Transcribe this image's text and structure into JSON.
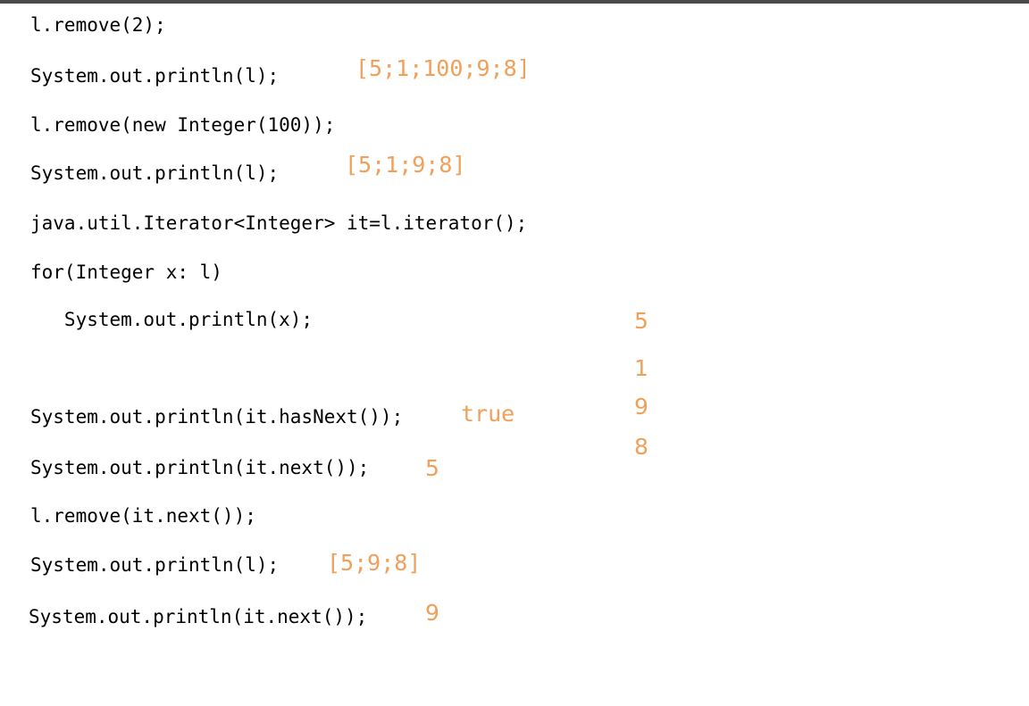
{
  "code_lines": [
    "l.remove(2);",
    "System.out.println(l);",
    "l.remove(new Integer(100));",
    "System.out.println(l);",
    "java.util.Iterator<Integer> it=l.iterator();",
    "for(Integer x: l)",
    "   System.out.println(x);",
    "System.out.println(it.hasNext());",
    "System.out.println(it.next());",
    "l.remove(it.next());",
    "System.out.println(l);",
    "System.out.println(it.next());"
  ],
  "annotations": {
    "after_remove_index": "[5;1;100;9;8]",
    "after_remove_object": "[5;1;9;8]",
    "loop_output": [
      "5",
      "1",
      "9",
      "8"
    ],
    "has_next": "true",
    "first_next": "5",
    "after_remove_next": "[5;9;8]",
    "last_next": "9"
  },
  "colors": {
    "code": "#000000",
    "annotation": "#f0a05a",
    "top_border": "#4a4a4a"
  }
}
